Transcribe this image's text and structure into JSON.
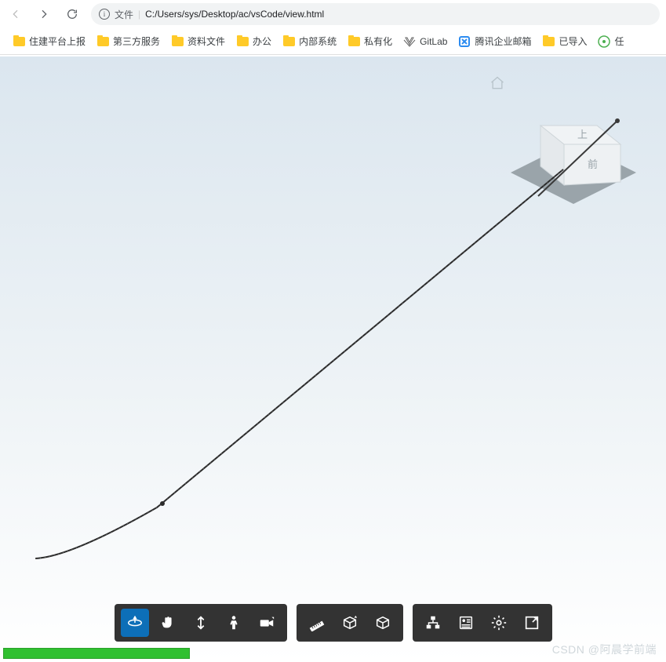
{
  "browser": {
    "url_prefix": "文件",
    "url_path": "C:/Users/sys/Desktop/ac/vsCode/view.html"
  },
  "bookmarks": [
    {
      "label": "住建平台上报",
      "icon": "folder"
    },
    {
      "label": "第三方服务",
      "icon": "folder"
    },
    {
      "label": "资料文件",
      "icon": "folder"
    },
    {
      "label": "办公",
      "icon": "folder"
    },
    {
      "label": "内部系统",
      "icon": "folder"
    },
    {
      "label": "私有化",
      "icon": "folder"
    },
    {
      "label": "GitLab",
      "icon": "gitlab"
    },
    {
      "label": "腾讯企业邮箱",
      "icon": "tencent"
    },
    {
      "label": "已导入",
      "icon": "folder"
    },
    {
      "label": "任",
      "icon": "green"
    }
  ],
  "viewcube": {
    "top_label": "上",
    "front_label": "前"
  },
  "toolbar": {
    "groups": [
      {
        "buttons": [
          "orbit",
          "pan",
          "zoom",
          "walk",
          "camera"
        ]
      },
      {
        "buttons": [
          "measure",
          "section",
          "explode"
        ]
      },
      {
        "buttons": [
          "model-tree",
          "properties",
          "settings",
          "fullscreen"
        ]
      }
    ],
    "active": "orbit"
  },
  "watermark": "CSDN @阿晨学前端"
}
